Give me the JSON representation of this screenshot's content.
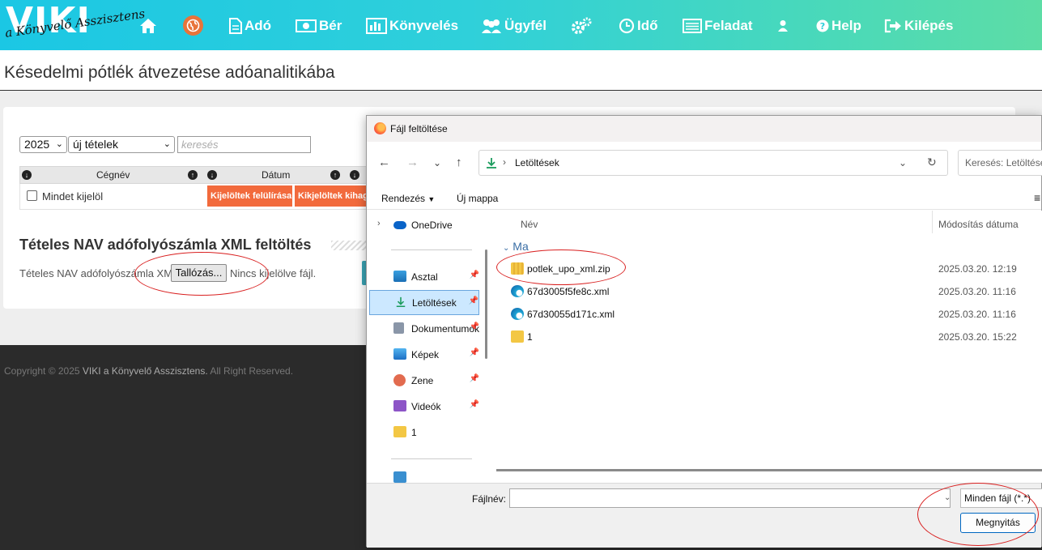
{
  "brand": {
    "logo": "VIKI",
    "tagline": "a Könyvelő Asszisztens"
  },
  "nav": {
    "items": [
      {
        "label": "Adó"
      },
      {
        "label": "Bér"
      },
      {
        "label": "Könyvelés"
      },
      {
        "label": "Ügyfél"
      },
      {
        "label": "Idő"
      },
      {
        "label": "Feladat"
      },
      {
        "label": "Help"
      },
      {
        "label": "Kilépés"
      }
    ],
    "active_color": "#e8743a"
  },
  "page": {
    "title": "Késedelmi pótlék átvezetése adóanalitikába"
  },
  "filters": {
    "year": "2025",
    "type": "új tételek",
    "search_placeholder": "keresés"
  },
  "grid": {
    "columns": [
      "Cégnév",
      "Dátum"
    ],
    "select_all": "Mindet kijelöl",
    "overwrite_button": "Kijelöltek felülírása",
    "skip_button": "Kikjelöltek kihagyása"
  },
  "upload": {
    "section_title": "Tételes NAV adófolyószámla XML feltöltés",
    "label": "Tételes NAV adófolyószámla XML:",
    "browse_button": "Tallózás...",
    "no_file": "Nincs kijelölve fájl."
  },
  "footer": {
    "copyright_prefix": "Copyright © 2025",
    "company": "VIKI a Könyvelő Asszisztens.",
    "rights": "All Right Reserved."
  },
  "dialog": {
    "title": "Fájl feltöltése",
    "path": "Letöltések",
    "search_placeholder": "Keresés: Letöltések",
    "organize": "Rendezés",
    "new_folder": "Új mappa",
    "nav_items": [
      {
        "label": "OneDrive",
        "icon": "cloud-icon",
        "pinned": false
      },
      {
        "label": "Asztal",
        "icon": "desktop-icon",
        "pinned": true
      },
      {
        "label": "Letöltések",
        "icon": "download-icon",
        "pinned": true
      },
      {
        "label": "Dokumentumok",
        "icon": "document-icon",
        "pinned": true
      },
      {
        "label": "Képek",
        "icon": "image-icon",
        "pinned": true
      },
      {
        "label": "Zene",
        "icon": "music-icon",
        "pinned": true
      },
      {
        "label": "Videók",
        "icon": "video-icon",
        "pinned": true
      },
      {
        "label": "1",
        "icon": "folder-icon",
        "pinned": false
      }
    ],
    "columns": {
      "name": "Név",
      "modified": "Módosítás dátuma"
    },
    "group": "Ma",
    "files": [
      {
        "name": "potlek_upo_xml.zip",
        "date": "2025.03.20. 12:19",
        "icon": "zip-folder-icon"
      },
      {
        "name": "67d3005f5fe8c.xml",
        "date": "2025.03.20. 11:16",
        "icon": "edge-icon"
      },
      {
        "name": "67d30055d171c.xml",
        "date": "2025.03.20. 11:16",
        "icon": "edge-icon"
      },
      {
        "name": "1",
        "date": "2025.03.20. 15:22",
        "icon": "folder-icon"
      }
    ],
    "filename_label": "Fájlnév:",
    "filename_value": "",
    "filter": "Minden fájl (*.*)",
    "open_button": "Megnyitás"
  },
  "annotation_color": "#d92020"
}
